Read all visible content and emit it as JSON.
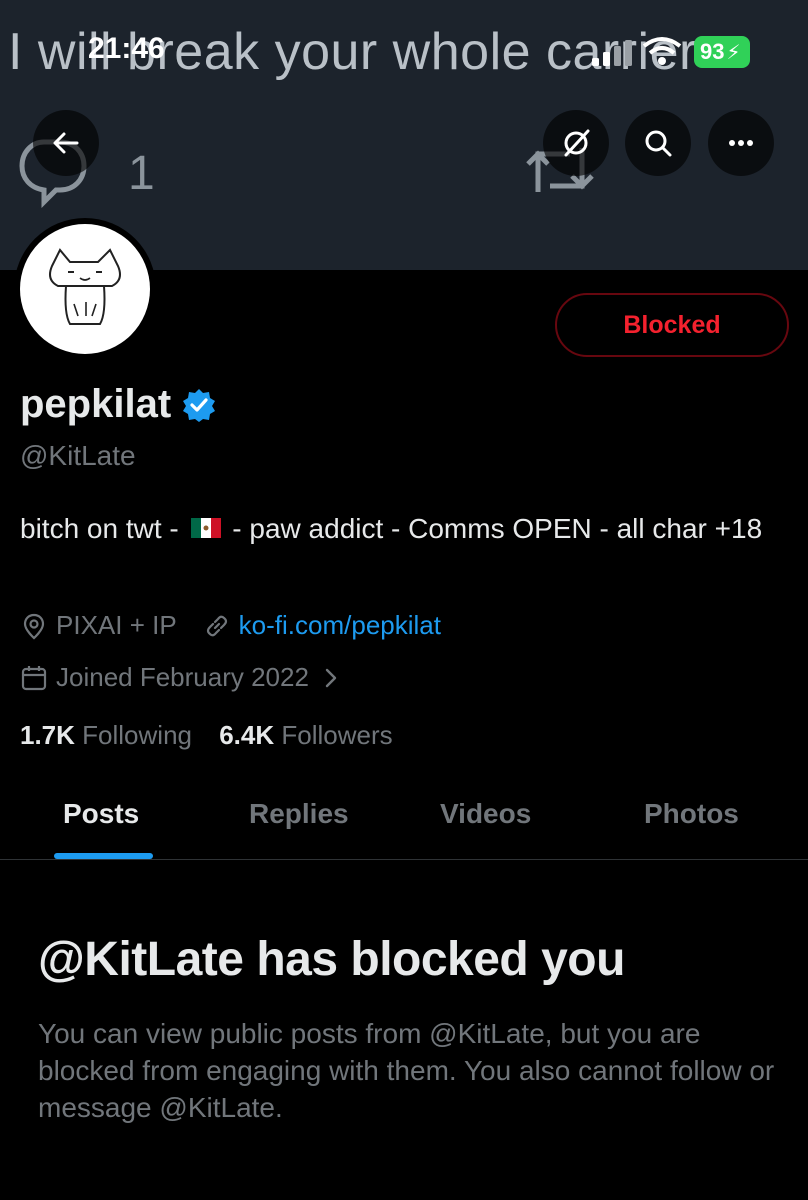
{
  "status_bar": {
    "time": "21:46",
    "battery": "93"
  },
  "banner": {
    "text": "I will break your whole carrier",
    "reply_count": "1"
  },
  "header_buttons": {
    "back": "back-arrow-icon",
    "unfollow": "grok-icon",
    "search": "search-icon",
    "more": "more-icon"
  },
  "profile": {
    "display_name": "pepkilat",
    "handle": "@KitLate",
    "bio_part1": "bitch on twt - ",
    "bio_part2": " - paw addict - Comms OPEN - all char +18",
    "location": "PIXAI + IP",
    "website": "ko-fi.com/pepkilat",
    "joined": "Joined February 2022",
    "following_count": "1.7K",
    "following_label": "Following",
    "followers_count": "6.4K",
    "followers_label": "Followers",
    "blocked_label": "Blocked"
  },
  "tabs": [
    {
      "label": "Posts"
    },
    {
      "label": "Replies"
    },
    {
      "label": "Videos"
    },
    {
      "label": "Photos"
    }
  ],
  "blocked_notice": {
    "title": "@KitLate has blocked you",
    "description": "You can view public posts from @KitLate, but you are blocked from engaging with them. You also cannot follow or message @KitLate."
  },
  "colors": {
    "accent": "#1d9bf0",
    "blocked_red": "#f4212e",
    "background": "#000000",
    "secondary_text": "#71767b"
  }
}
